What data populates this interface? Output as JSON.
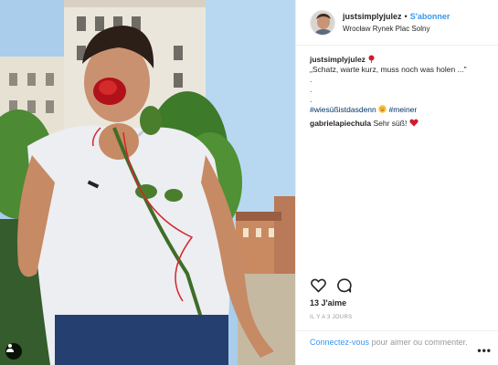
{
  "header": {
    "username": "justsimplyjulez",
    "separator": "•",
    "follow_label": "S'abonner",
    "location": "Wrocław Rynek Plac Solny"
  },
  "caption": {
    "username": "justsimplyjulez",
    "line1": "„Schatz, warte kurz, muss noch was holen ...\"",
    "line2": ".",
    "line3": ".",
    "line4": ".",
    "hashtag1": "#wiesüßistdasdenn",
    "hashtag2": "#meiner"
  },
  "comment": {
    "username": "gabrielapiechula",
    "text": "Sehr süß!"
  },
  "likes": "13 J'aime",
  "timestamp": "IL Y A 3 JOURS",
  "footer": {
    "login_link": "Connectez-vous",
    "login_text": "pour aimer ou commenter."
  },
  "more_label": "•••",
  "icons": {
    "heart": "heart-icon",
    "comment": "comment-icon",
    "user_tag": "user-tag-icon",
    "rose": "rose-emoji-icon",
    "heart_eyes": "heart-eyes-emoji-icon",
    "red_heart": "red-heart-emoji-icon"
  },
  "colors": {
    "link_blue": "#3897f0",
    "hashtag_blue": "#003569",
    "muted_gray": "#999999"
  }
}
